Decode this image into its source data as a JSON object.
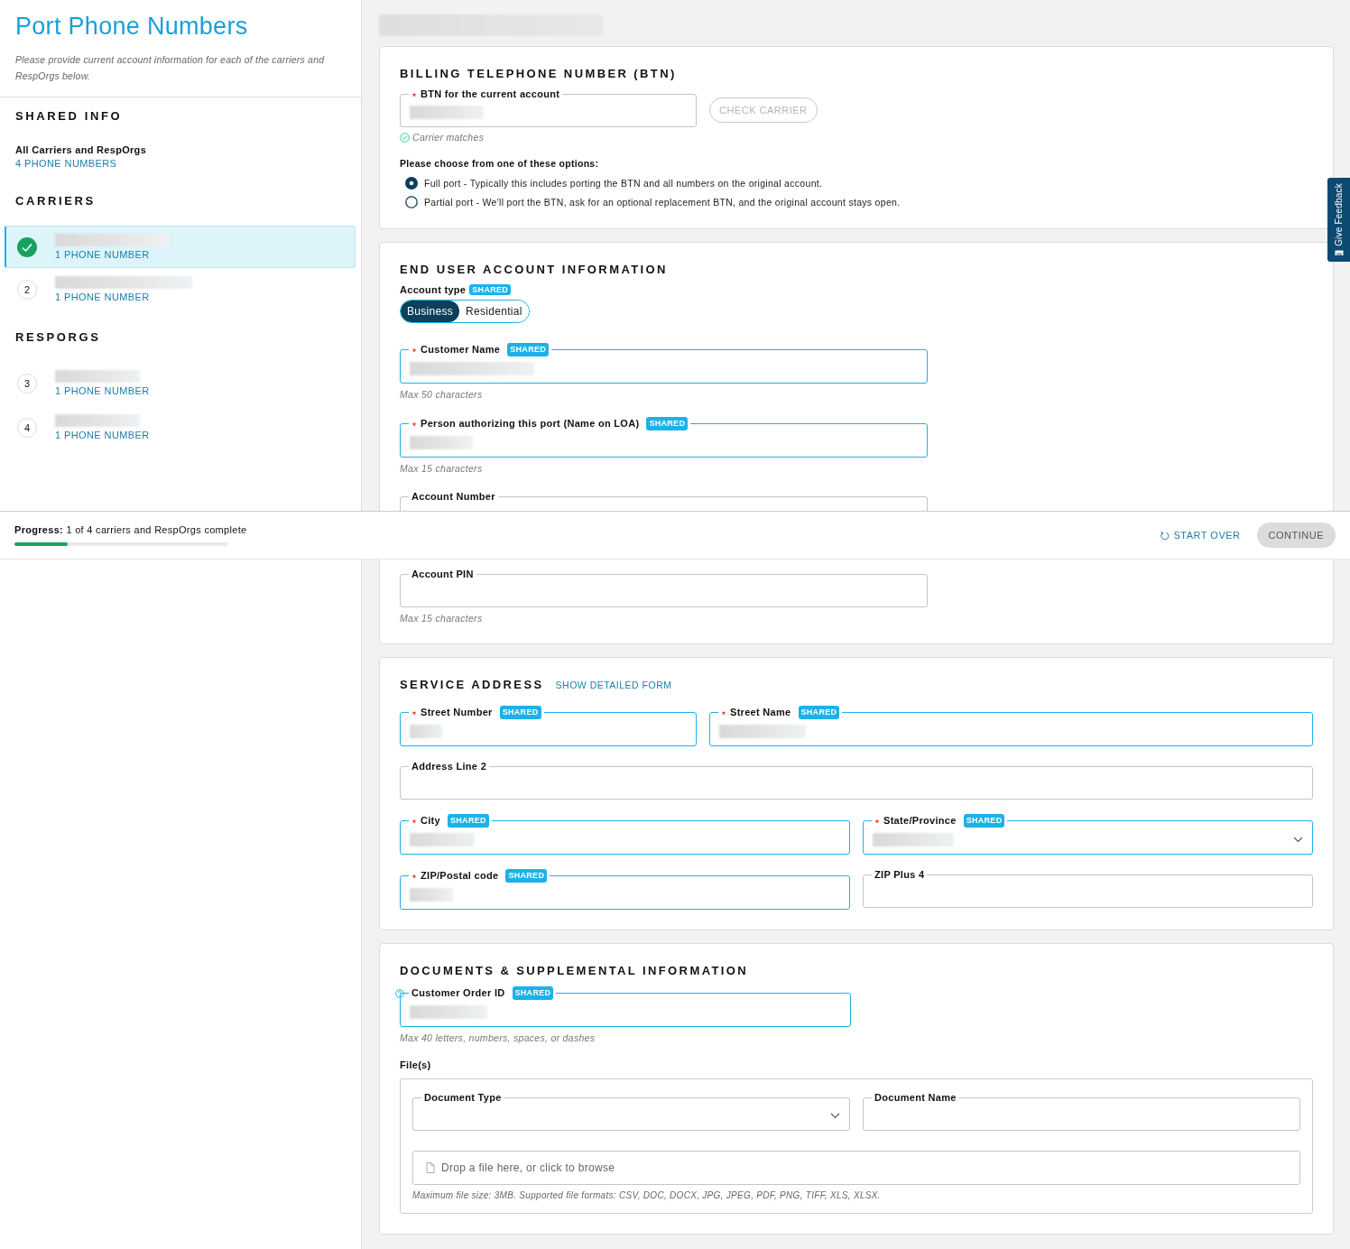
{
  "sidebar": {
    "title": "Port Phone Numbers",
    "subtitle": "Please provide current account information for each of the carriers and RespOrgs below.",
    "shared_info": {
      "heading": "SHARED INFO",
      "name": "All Carriers and RespOrgs",
      "count": "4 PHONE NUMBERS"
    },
    "groups": [
      {
        "heading": "CARRIERS",
        "items": [
          {
            "complete": true,
            "selected": true,
            "count": "1 PHONE NUMBER"
          },
          {
            "number": "2",
            "complete": false,
            "selected": false,
            "count": "1 PHONE NUMBER"
          }
        ]
      },
      {
        "heading": "RESPORGS",
        "items": [
          {
            "number": "3",
            "complete": false,
            "selected": false,
            "count": "1 PHONE NUMBER"
          },
          {
            "number": "4",
            "complete": false,
            "selected": false,
            "count": "1 PHONE NUMBER"
          }
        ]
      }
    ]
  },
  "sections": [
    {
      "kind": "btn",
      "heading": "BILLING TELEPHONE NUMBER (BTN)",
      "field": {
        "label": "BTN for the current account",
        "required": true,
        "highlighted": false,
        "filled": true
      },
      "button": {
        "label": "CHECK CARRIER",
        "disabled": true
      },
      "status": "Carrier matches",
      "question": "Please choose from one of these options:",
      "options": [
        {
          "label": "Full port - Typically this includes porting the BTN and all numbers on the original account.",
          "selected": true
        },
        {
          "label": "Partial port - We'll port the BTN, ask for an optional replacement BTN, and the original account stays open.",
          "selected": false
        }
      ]
    },
    {
      "kind": "account",
      "heading": "END USER ACCOUNT INFORMATION",
      "account_type": {
        "label": "Account type",
        "badge": "SHARED",
        "options": [
          {
            "label": "Business",
            "selected": true
          },
          {
            "label": "Residential",
            "selected": false
          }
        ]
      },
      "fields": [
        {
          "label": "Customer Name",
          "required": true,
          "badge": "SHARED",
          "highlighted": true,
          "filled": true,
          "hint": "Max 50 characters"
        },
        {
          "label": "Person authorizing this port (Name on LOA)",
          "required": true,
          "badge": "SHARED",
          "highlighted": true,
          "filled": true,
          "hint": "Max 15 characters"
        },
        {
          "label": "Account Number",
          "required": false,
          "highlighted": false,
          "filled": false
        },
        {
          "label": "Account PIN",
          "required": false,
          "highlighted": false,
          "filled": false,
          "hint": "Max 15 characters"
        }
      ]
    },
    {
      "kind": "address",
      "heading": "SERVICE ADDRESS",
      "link": "SHOW DETAILED FORM",
      "fields": [
        {
          "label": "Street Number",
          "required": true,
          "badge": "SHARED",
          "highlighted": true,
          "filled": true
        },
        {
          "label": "Street Name",
          "required": true,
          "badge": "SHARED",
          "highlighted": true,
          "filled": true
        },
        {
          "label": "Address Line 2",
          "required": false,
          "highlighted": false,
          "filled": false
        },
        {
          "label": "City",
          "required": true,
          "badge": "SHARED",
          "highlighted": true,
          "filled": true
        },
        {
          "label": "State/Province",
          "required": true,
          "badge": "SHARED",
          "highlighted": true,
          "filled": true,
          "dropdown": true
        },
        {
          "label": "ZIP/Postal code",
          "required": true,
          "badge": "SHARED",
          "highlighted": true,
          "filled": true
        },
        {
          "label": "ZIP Plus 4",
          "required": false,
          "highlighted": false,
          "filled": false
        }
      ]
    },
    {
      "kind": "documents",
      "heading": "DOCUMENTS & SUPPLEMENTAL INFORMATION",
      "field": {
        "label": "Customer Order ID",
        "required": false,
        "help": true,
        "badge": "SHARED",
        "highlighted": true,
        "filled": true,
        "hint": "Max 40 letters, numbers, spaces, or dashes"
      },
      "files_label": "File(s)",
      "files": {
        "fields": [
          {
            "label": "Document Type",
            "required": false,
            "highlighted": false,
            "filled": false,
            "dropdown": true
          },
          {
            "label": "Document Name",
            "required": false,
            "highlighted": false,
            "filled": false
          }
        ],
        "drop_text": "Drop a file here, or click to browse",
        "note": "Maximum file size: 3MB. Supported file formats: CSV, DOC, DOCX, JPG, JPEG, PDF, PNG, TIFF, XLS, XLSX."
      }
    }
  ],
  "footer": {
    "progress_label": "Progress:",
    "progress_text": "1 of 4 carriers and RespOrgs complete",
    "level": 0.25,
    "start_over": "START OVER",
    "continue": {
      "label": "CONTINUE",
      "disabled": true
    }
  },
  "feedback": "Give Feedback"
}
